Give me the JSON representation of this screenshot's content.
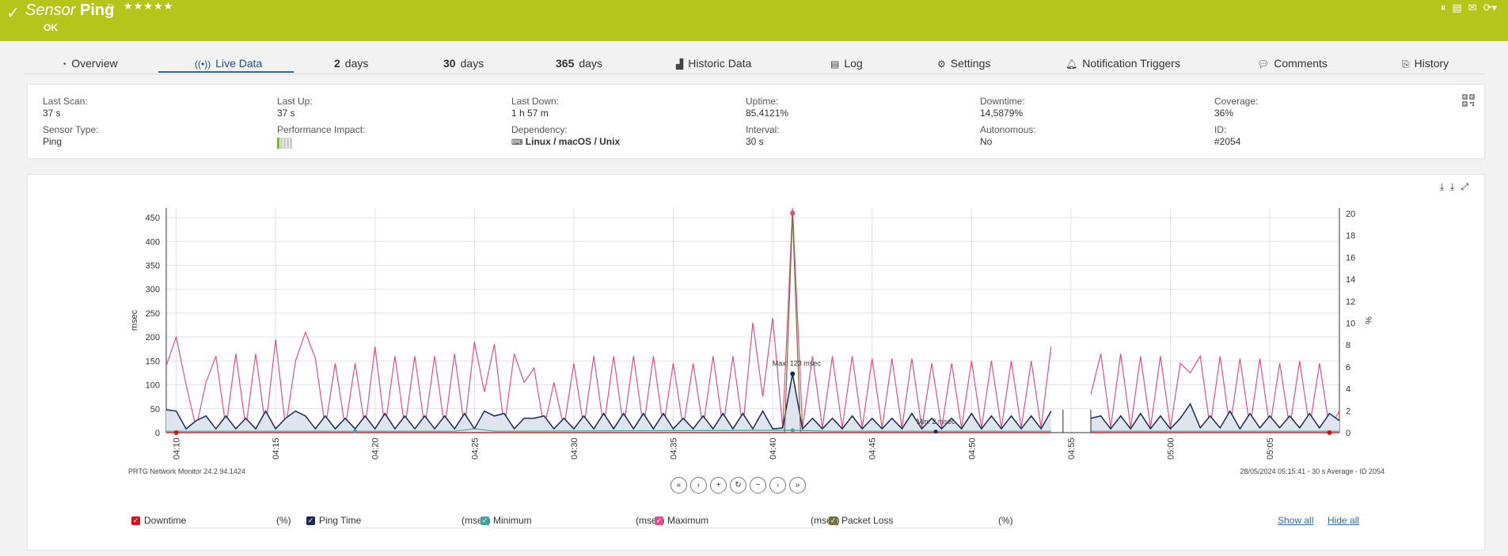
{
  "header": {
    "sensor_word": "Sensor",
    "sensor_name": "Ping",
    "stars": "★★★★★",
    "status": "OK"
  },
  "tabs": [
    {
      "label": "Overview",
      "icon": "gauge-icon"
    },
    {
      "label": "Live Data",
      "icon": "live-signal-icon"
    },
    {
      "num": "2",
      "label": "days"
    },
    {
      "num": "30",
      "label": "days"
    },
    {
      "num": "365",
      "label": "days"
    },
    {
      "label": "Historic Data",
      "icon": "area-chart-icon"
    },
    {
      "label": "Log",
      "icon": "log-icon"
    },
    {
      "label": "Settings",
      "icon": "gear-icon"
    },
    {
      "label": "Notification Triggers",
      "icon": "bell-icon"
    },
    {
      "label": "Comments",
      "icon": "comment-icon"
    },
    {
      "label": "History",
      "icon": "history-icon"
    }
  ],
  "info": {
    "last_scan": {
      "label": "Last Scan:",
      "value": "37 s"
    },
    "last_up": {
      "label": "Last Up:",
      "value": "37 s"
    },
    "last_down": {
      "label": "Last Down:",
      "value": "1 h 57 m"
    },
    "uptime": {
      "label": "Uptime:",
      "value": "85,4121%"
    },
    "downtime": {
      "label": "Downtime:",
      "value": "14,5879%"
    },
    "coverage": {
      "label": "Coverage:",
      "value": "36%"
    },
    "sensor_type": {
      "label": "Sensor Type:",
      "value": "Ping"
    },
    "performance_impact": {
      "label": "Performance Impact:",
      "level": 0.2
    },
    "dependency": {
      "label": "Dependency:",
      "value": "Linux / macOS / Unix"
    },
    "interval": {
      "label": "Interval:",
      "value": "30 s"
    },
    "autonomous": {
      "label": "Autonomous:",
      "value": "No"
    },
    "id": {
      "label": "ID:",
      "value": "#2054"
    }
  },
  "chart_footer": {
    "left": "PRTG Network Monitor 24.2.94.1424",
    "right": "28/05/2024 05:15:41 - 30 s Average - ID 2054"
  },
  "nav_buttons": [
    "«",
    "‹",
    "+",
    "↻",
    "−",
    "›",
    "»"
  ],
  "legend": [
    {
      "name": "Downtime",
      "unit": "(%)",
      "color": "#d0161b"
    },
    {
      "name": "Ping Time",
      "unit": "(msec)",
      "color": "#1b2a55"
    },
    {
      "name": "Minimum",
      "unit": "(msec)",
      "color": "#3aa8a0"
    },
    {
      "name": "Maximum",
      "unit": "(msec)",
      "color": "#e0508a"
    },
    {
      "name": "Packet Loss",
      "unit": "(%)",
      "color": "#76703a"
    }
  ],
  "links": {
    "show_all": "Show all",
    "hide_all": "Hide all"
  },
  "chart_data": {
    "type": "line",
    "x_ticks": [
      "04:10",
      "04:15",
      "04:20",
      "04:25",
      "04:30",
      "04:35",
      "04:40",
      "04:45",
      "04:50",
      "04:55",
      "05:00",
      "05:05"
    ],
    "ylabel_left": "msec",
    "ylabel_right": "%",
    "ylim_left": [
      0,
      470
    ],
    "ylim_right": [
      0,
      20.5
    ],
    "yticks_left": [
      0,
      50,
      100,
      150,
      200,
      250,
      300,
      350,
      400,
      450
    ],
    "yticks_right": [
      0,
      2,
      4,
      6,
      8,
      10,
      12,
      14,
      16,
      18,
      20
    ],
    "annotations": [
      {
        "text": "Max: 123 msec",
        "x_min": 31.2,
        "y": 123
      },
      {
        "text": "Min: 2 msec",
        "x_min": 38.2,
        "y": 2
      }
    ],
    "x_range_min": [
      -0.5,
      58.5
    ],
    "gap_min": [
      44.6,
      46.0
    ],
    "series": [
      {
        "name": "Maximum",
        "axis": "left",
        "color": "#e0508a",
        "points": [
          [
            -0.5,
            140
          ],
          [
            0,
            200
          ],
          [
            0.5,
            100
          ],
          [
            1,
            10
          ],
          [
            1.5,
            105
          ],
          [
            2,
            160
          ],
          [
            2.5,
            10
          ],
          [
            3,
            165
          ],
          [
            3.5,
            10
          ],
          [
            4,
            165
          ],
          [
            4.5,
            10
          ],
          [
            5,
            195
          ],
          [
            5.5,
            10
          ],
          [
            6,
            150
          ],
          [
            6.5,
            210
          ],
          [
            7,
            155
          ],
          [
            7.5,
            10
          ],
          [
            8,
            145
          ],
          [
            8.5,
            10
          ],
          [
            9,
            145
          ],
          [
            9.5,
            10
          ],
          [
            10,
            180
          ],
          [
            10.5,
            10
          ],
          [
            11,
            160
          ],
          [
            11.5,
            10
          ],
          [
            12,
            160
          ],
          [
            12.5,
            10
          ],
          [
            13,
            160
          ],
          [
            13.5,
            10
          ],
          [
            14,
            165
          ],
          [
            14.5,
            10
          ],
          [
            15,
            190
          ],
          [
            15.5,
            85
          ],
          [
            16,
            185
          ],
          [
            16.5,
            10
          ],
          [
            17,
            165
          ],
          [
            17.5,
            105
          ],
          [
            18,
            135
          ],
          [
            18.5,
            10
          ],
          [
            19,
            105
          ],
          [
            19.5,
            10
          ],
          [
            20,
            145
          ],
          [
            20.5,
            10
          ],
          [
            21,
            160
          ],
          [
            21.5,
            10
          ],
          [
            22,
            160
          ],
          [
            22.5,
            10
          ],
          [
            23,
            160
          ],
          [
            23.5,
            10
          ],
          [
            24,
            160
          ],
          [
            24.5,
            10
          ],
          [
            25,
            145
          ],
          [
            25.5,
            10
          ],
          [
            26,
            145
          ],
          [
            26.5,
            10
          ],
          [
            27,
            160
          ],
          [
            27.5,
            10
          ],
          [
            28,
            160
          ],
          [
            28.5,
            10
          ],
          [
            29,
            230
          ],
          [
            29.5,
            75
          ],
          [
            30,
            240
          ],
          [
            30.5,
            10
          ],
          [
            31,
            470
          ],
          [
            31.5,
            10
          ],
          [
            32,
            160
          ],
          [
            32.5,
            10
          ],
          [
            33,
            160
          ],
          [
            33.5,
            10
          ],
          [
            34,
            160
          ],
          [
            34.5,
            10
          ],
          [
            35,
            155
          ],
          [
            35.5,
            10
          ],
          [
            36,
            155
          ],
          [
            36.5,
            10
          ],
          [
            37,
            155
          ],
          [
            37.5,
            10
          ],
          [
            38,
            145
          ],
          [
            38.5,
            10
          ],
          [
            39,
            145
          ],
          [
            39.5,
            10
          ],
          [
            40,
            150
          ],
          [
            40.5,
            10
          ],
          [
            41,
            150
          ],
          [
            41.5,
            10
          ],
          [
            42,
            150
          ],
          [
            42.5,
            10
          ],
          [
            43,
            150
          ],
          [
            43.5,
            10
          ],
          [
            44,
            180
          ],
          [
            46,
            80
          ],
          [
            46.5,
            165
          ],
          [
            47,
            10
          ],
          [
            47.5,
            165
          ],
          [
            48,
            10
          ],
          [
            48.5,
            160
          ],
          [
            49,
            10
          ],
          [
            49.5,
            160
          ],
          [
            50,
            10
          ],
          [
            50.5,
            145
          ],
          [
            51,
            125
          ],
          [
            51.5,
            160
          ],
          [
            52,
            10
          ],
          [
            52.5,
            160
          ],
          [
            53,
            10
          ],
          [
            53.5,
            155
          ],
          [
            54,
            10
          ],
          [
            54.5,
            155
          ],
          [
            55,
            10
          ],
          [
            55.5,
            145
          ],
          [
            56,
            10
          ],
          [
            56.5,
            150
          ],
          [
            57,
            10
          ],
          [
            57.5,
            145
          ],
          [
            58,
            10
          ],
          [
            58.5,
            45
          ]
        ]
      },
      {
        "name": "Ping Time",
        "axis": "left",
        "color": "#1b2a55",
        "fill": "#dfe5ee",
        "points": [
          [
            -0.5,
            48
          ],
          [
            0,
            45
          ],
          [
            0.5,
            8
          ],
          [
            1,
            25
          ],
          [
            1.5,
            35
          ],
          [
            2,
            8
          ],
          [
            2.5,
            35
          ],
          [
            3,
            8
          ],
          [
            3.5,
            30
          ],
          [
            4,
            8
          ],
          [
            4.5,
            45
          ],
          [
            5,
            8
          ],
          [
            5.5,
            30
          ],
          [
            6,
            45
          ],
          [
            6.5,
            35
          ],
          [
            7,
            8
          ],
          [
            7.5,
            35
          ],
          [
            8,
            8
          ],
          [
            8.5,
            30
          ],
          [
            9,
            8
          ],
          [
            9.5,
            35
          ],
          [
            10,
            8
          ],
          [
            10.5,
            40
          ],
          [
            11,
            8
          ],
          [
            11.5,
            35
          ],
          [
            12,
            8
          ],
          [
            12.5,
            35
          ],
          [
            13,
            8
          ],
          [
            13.5,
            35
          ],
          [
            14,
            8
          ],
          [
            14.5,
            40
          ],
          [
            15,
            8
          ],
          [
            15.5,
            45
          ],
          [
            16,
            35
          ],
          [
            16.5,
            40
          ],
          [
            17,
            8
          ],
          [
            17.5,
            30
          ],
          [
            18,
            30
          ],
          [
            18.5,
            35
          ],
          [
            19,
            8
          ],
          [
            19.5,
            30
          ],
          [
            20,
            8
          ],
          [
            20.5,
            35
          ],
          [
            21,
            8
          ],
          [
            21.5,
            40
          ],
          [
            22,
            8
          ],
          [
            22.5,
            40
          ],
          [
            23,
            8
          ],
          [
            23.5,
            40
          ],
          [
            24,
            8
          ],
          [
            24.5,
            40
          ],
          [
            25,
            8
          ],
          [
            25.5,
            30
          ],
          [
            26,
            8
          ],
          [
            26.5,
            35
          ],
          [
            27,
            8
          ],
          [
            27.5,
            40
          ],
          [
            28,
            8
          ],
          [
            28.5,
            40
          ],
          [
            29,
            8
          ],
          [
            29.5,
            45
          ],
          [
            30,
            8
          ],
          [
            30.5,
            10
          ],
          [
            31,
            123
          ],
          [
            31.5,
            8
          ],
          [
            32,
            30
          ],
          [
            32.5,
            8
          ],
          [
            33,
            30
          ],
          [
            33.5,
            8
          ],
          [
            34,
            35
          ],
          [
            34.5,
            8
          ],
          [
            35,
            30
          ],
          [
            35.5,
            8
          ],
          [
            36,
            30
          ],
          [
            36.5,
            8
          ],
          [
            37,
            40
          ],
          [
            37.5,
            8
          ],
          [
            38,
            30
          ],
          [
            38.5,
            8
          ],
          [
            39,
            30
          ],
          [
            39.5,
            8
          ],
          [
            40,
            40
          ],
          [
            40.5,
            8
          ],
          [
            41,
            35
          ],
          [
            41.5,
            8
          ],
          [
            42,
            35
          ],
          [
            42.5,
            8
          ],
          [
            43,
            35
          ],
          [
            43.5,
            8
          ],
          [
            44,
            45
          ],
          [
            46,
            30
          ],
          [
            46.5,
            35
          ],
          [
            47,
            8
          ],
          [
            47.5,
            35
          ],
          [
            48,
            8
          ],
          [
            48.5,
            40
          ],
          [
            49,
            8
          ],
          [
            49.5,
            35
          ],
          [
            50,
            8
          ],
          [
            50.5,
            30
          ],
          [
            51,
            60
          ],
          [
            51.5,
            10
          ],
          [
            52,
            35
          ],
          [
            52.5,
            10
          ],
          [
            53,
            45
          ],
          [
            53.5,
            8
          ],
          [
            54,
            40
          ],
          [
            54.5,
            10
          ],
          [
            55,
            35
          ],
          [
            55.5,
            10
          ],
          [
            56,
            35
          ],
          [
            56.5,
            10
          ],
          [
            57,
            40
          ],
          [
            57.5,
            10
          ],
          [
            58,
            40
          ],
          [
            58.5,
            25
          ]
        ]
      },
      {
        "name": "Minimum",
        "axis": "left",
        "color": "#3aa8a0",
        "points": [
          [
            -0.5,
            3
          ],
          [
            14,
            3
          ],
          [
            15,
            8
          ],
          [
            16,
            3
          ],
          [
            31,
            5
          ],
          [
            33,
            3
          ],
          [
            44,
            3
          ],
          [
            46,
            3
          ],
          [
            58.5,
            3
          ]
        ]
      },
      {
        "name": "Packet Loss",
        "axis": "right",
        "color": "#76703a",
        "points": [
          [
            -0.5,
            0
          ],
          [
            30.6,
            0
          ],
          [
            31,
            20
          ],
          [
            31.4,
            0
          ],
          [
            44,
            0
          ],
          [
            46,
            0
          ],
          [
            58.5,
            0
          ]
        ]
      },
      {
        "name": "Downtime",
        "axis": "right",
        "color": "#d0161b",
        "points": [
          [
            -0.5,
            0
          ],
          [
            44,
            0
          ],
          [
            46,
            0
          ],
          [
            58.5,
            0
          ]
        ]
      }
    ]
  }
}
